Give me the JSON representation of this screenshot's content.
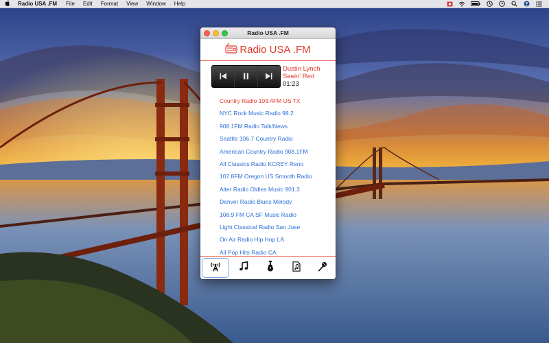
{
  "menubar": {
    "apple_icon": "apple-logo-icon",
    "app_name": "Radio USA .FM",
    "menus": [
      "File",
      "Edit",
      "Format",
      "View",
      "Window",
      "Help"
    ],
    "status_icons": [
      "record-icon",
      "wifi-icon",
      "battery-icon",
      "clock-icon",
      "time-machine-icon",
      "spotlight-search-icon",
      "user-icon",
      "notification-center-icon"
    ]
  },
  "window": {
    "title": "Radio USA .FM",
    "logo_text": "Radio USA .FM",
    "player": {
      "artist": "Dustin Lynch",
      "track": "Seein' Red",
      "time": "01:23"
    },
    "stations": [
      "Country Radio 103.4FM US TX",
      "NYC Rock Music Radio 98.2",
      "908.1FM Radio Talk/News",
      "Seattle 106.7 Country Radio",
      "American Country Radio 908.1FM",
      "All Classics Radio KCREY Reno",
      "107.8FM Oregon US Smooth Radio",
      "Alter Radio Oldies Music 901.3",
      "Denver Radio Blues Melody",
      "108.9 FM CA SF Music Radio",
      "Light Classical Radio San Jose",
      "On Air Radio Hip Hop LA",
      "All Pop Hits Radio CA"
    ],
    "active_station_index": 0,
    "tabs": [
      "radio-tower-icon",
      "music-note-icon",
      "guitar-icon",
      "music-file-icon",
      "microphone-icon"
    ],
    "selected_tab_index": 0
  },
  "colors": {
    "accent_red": "#e4372b",
    "link_blue": "#2c6fd6"
  }
}
